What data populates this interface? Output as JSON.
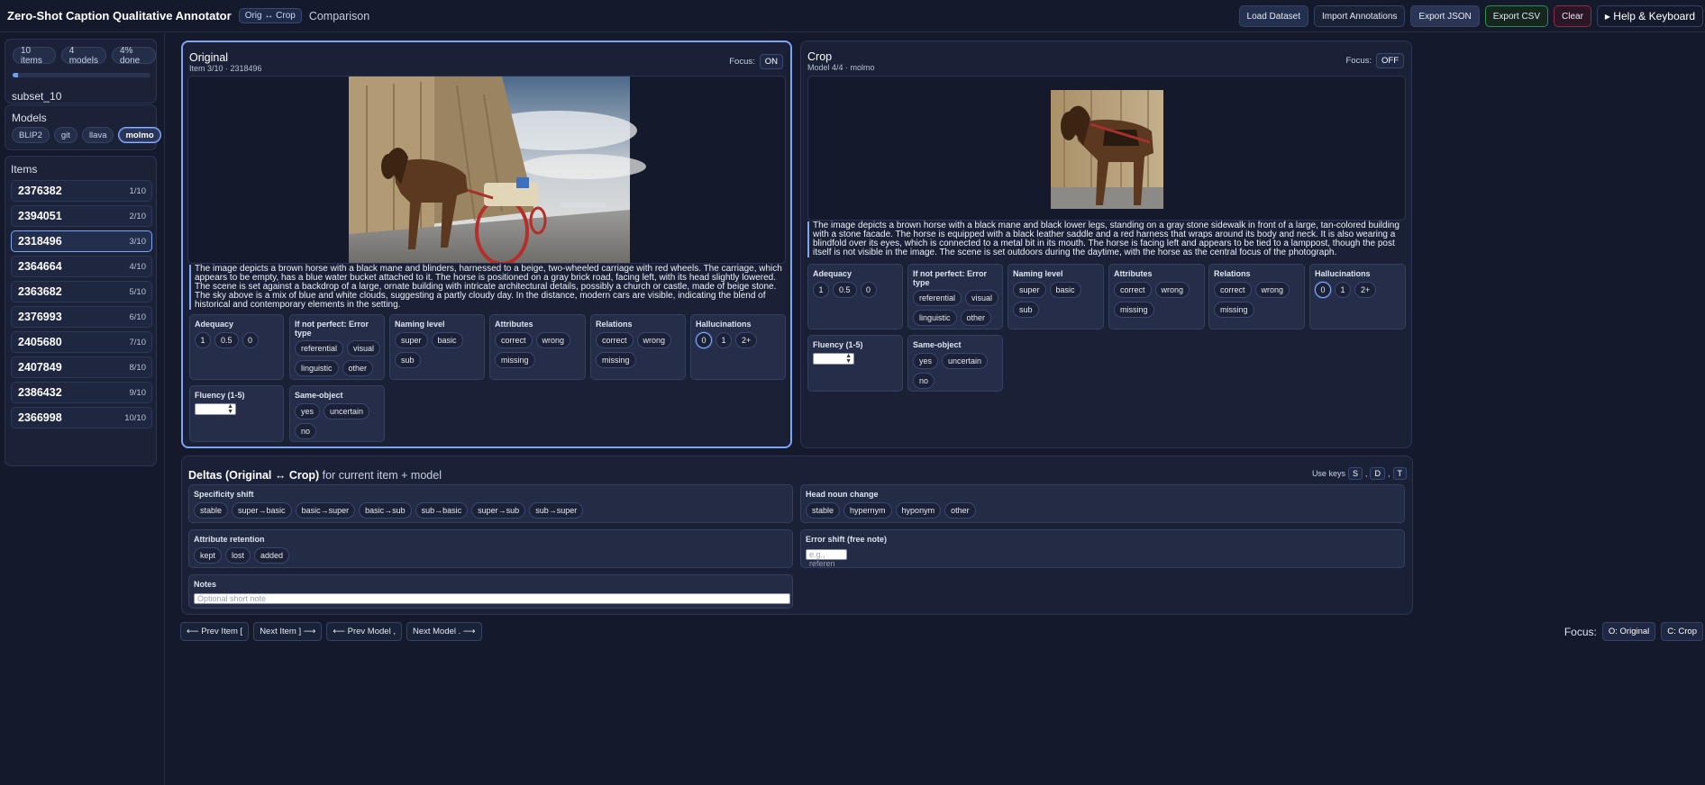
{
  "header": {
    "app_title": "Zero-Shot Caption Qualitative Annotator",
    "mode_badge": "Orig ↔ Crop",
    "mode_label": "Comparison",
    "buttons": {
      "load": "Load Dataset",
      "import": "Import Annotations",
      "export_json": "Export JSON",
      "export_csv": "Export CSV",
      "clear": "Clear",
      "help": "▸ Help & Keyboard"
    }
  },
  "sidebar": {
    "stats": {
      "items": "10 items",
      "models": "4 models",
      "done": "4% done",
      "progress": 0.04
    },
    "subset": "subset_10",
    "models_label": "Models",
    "models": [
      "BLIP2",
      "git",
      "llava",
      "molmo"
    ],
    "active_model": "molmo",
    "items_label": "Items",
    "items": [
      {
        "id": "2376382",
        "pos": "1/10"
      },
      {
        "id": "2394051",
        "pos": "2/10"
      },
      {
        "id": "2318496",
        "pos": "3/10"
      },
      {
        "id": "2364664",
        "pos": "4/10"
      },
      {
        "id": "2363682",
        "pos": "5/10"
      },
      {
        "id": "2376993",
        "pos": "6/10"
      },
      {
        "id": "2405680",
        "pos": "7/10"
      },
      {
        "id": "2407849",
        "pos": "8/10"
      },
      {
        "id": "2386432",
        "pos": "9/10"
      },
      {
        "id": "2366998",
        "pos": "10/10"
      }
    ],
    "selected_item": "2318496"
  },
  "original": {
    "title": "Original",
    "subtitle": "Item 3/10 · 2318496",
    "focus_label": "Focus:",
    "focus_state": "ON",
    "caption": "The image depicts a brown horse with a black mane and blinders, harnessed to a beige, two-wheeled carriage with red wheels. The carriage, which appears to be empty, has a blue water bucket attached to it. The horse is positioned on a gray brick road, facing left, with its head slightly lowered. The scene is set against a backdrop of a large, ornate building with intricate architectural details, possibly a church or castle, made of beige stone. The sky above is a mix of blue and white clouds, suggesting a partly cloudy day. In the distance, modern cars are visible, indicating the blend of historical and contemporary elements in the setting."
  },
  "crop": {
    "title": "Crop",
    "subtitle": "Model 4/4 · molmo",
    "focus_label": "Focus:",
    "focus_state": "OFF",
    "caption": "The image depicts a brown horse with a black mane and black lower legs, standing on a gray stone sidewalk in front of a large, tan-colored building with a stone facade. The horse is equipped with a black leather saddle and a red harness that wraps around its body and neck. It is also wearing a blindfold over its eyes, which is connected to a metal bit in its mouth. The horse is facing left and appears to be tied to a lamppost, though the post itself is not visible in the image. The scene is set outdoors during the daytime, with the horse as the central focus of the photograph."
  },
  "questions": {
    "adequacy": {
      "label": "Adequacy",
      "options": [
        "1",
        "0.5",
        "0"
      ]
    },
    "error_type": {
      "label": "If not perfect: Error type",
      "options": [
        "referential",
        "visual",
        "linguistic",
        "other"
      ]
    },
    "naming": {
      "label": "Naming level",
      "options": [
        "super",
        "basic",
        "sub"
      ]
    },
    "attributes": {
      "label": "Attributes",
      "options": [
        "correct",
        "wrong",
        "missing"
      ]
    },
    "relations": {
      "label": "Relations",
      "options": [
        "correct",
        "wrong",
        "missing"
      ]
    },
    "hallucinations": {
      "label": "Hallucinations",
      "options": [
        "0",
        "1",
        "2+"
      ],
      "selected": "0"
    },
    "fluency": {
      "label": "Fluency (1-5)"
    },
    "same_object": {
      "label": "Same-object",
      "options": [
        "yes",
        "uncertain",
        "no"
      ]
    }
  },
  "deltas": {
    "title_bold": "Deltas (Original ↔ Crop)",
    "title_rest": " for current item + model",
    "keys_label": "Use keys",
    "keys": [
      "S",
      "D",
      "T"
    ],
    "specificity": {
      "label": "Specificity shift",
      "options": [
        "stable",
        "super→basic",
        "basic→super",
        "basic→sub",
        "sub→basic",
        "super→sub",
        "sub→super"
      ]
    },
    "head_noun": {
      "label": "Head noun change",
      "options": [
        "stable",
        "hypernym",
        "hyponym",
        "other"
      ]
    },
    "attr_retention": {
      "label": "Attribute retention",
      "options": [
        "kept",
        "lost",
        "added"
      ]
    },
    "error_shift": {
      "label": "Error shift (free note)",
      "placeholder": "e.g., referen"
    },
    "notes": {
      "label": "Notes",
      "placeholder": "Optional short note"
    }
  },
  "nav": {
    "prev_item": "⟵ Prev Item [",
    "next_item": "Next Item ] ⟶",
    "prev_model": "⟵ Prev Model ,",
    "next_model": "Next Model . ⟶",
    "focus_label": "Focus:",
    "focus_original": "O: Original",
    "focus_crop": "C: Crop"
  },
  "colors": {
    "accent": "#7ea4f3",
    "background": "#141a2c",
    "panel": "#1a2137",
    "export_csv": "#2f8f4a",
    "clear": "#8e2b3c"
  }
}
